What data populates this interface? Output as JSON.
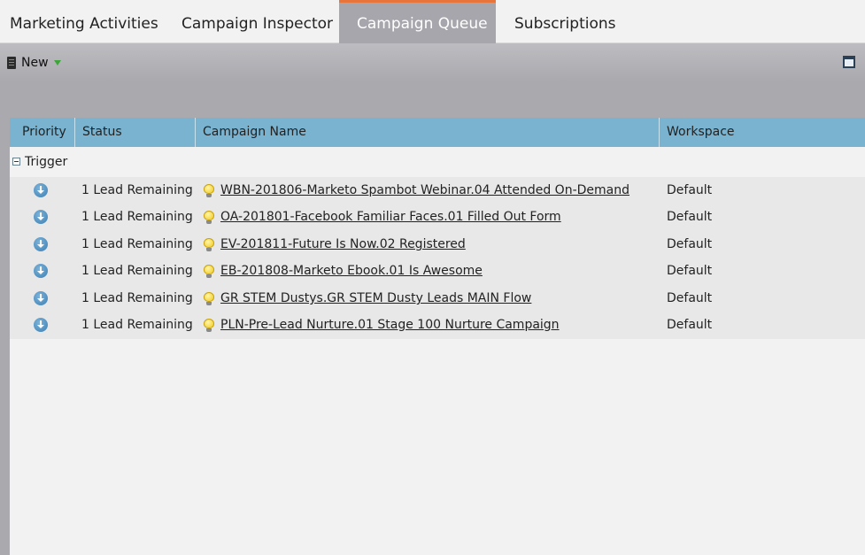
{
  "tabs": [
    {
      "label": "Marketing Activities",
      "active": false
    },
    {
      "label": "Campaign Inspector",
      "active": false
    },
    {
      "label": "Campaign Queue",
      "active": true
    },
    {
      "label": "Subscriptions",
      "active": false
    }
  ],
  "toolbar": {
    "new_label": "New",
    "new_icon": "document-icon",
    "new_caret_icon": "dropdown-caret-icon",
    "window_icon": "maximize-window-icon"
  },
  "grid": {
    "columns": [
      "Priority",
      "Status",
      "Campaign Name",
      "Workspace"
    ],
    "group": {
      "label": "Trigger",
      "icon": "collapse-icon"
    },
    "rows": [
      {
        "priority_icon": "priority-down-arrow-icon",
        "status": "1 Lead Remaining",
        "campaign_icon": "lightbulb-icon",
        "campaign_name": "WBN-201806-Marketo Spambot Webinar.04 Attended On-Demand",
        "workspace": "Default"
      },
      {
        "priority_icon": "priority-down-arrow-icon",
        "status": "1 Lead Remaining",
        "campaign_icon": "lightbulb-icon",
        "campaign_name": "OA-201801-Facebook Familiar Faces.01 Filled Out Form",
        "workspace": "Default"
      },
      {
        "priority_icon": "priority-down-arrow-icon",
        "status": "1 Lead Remaining",
        "campaign_icon": "lightbulb-icon",
        "campaign_name": "EV-201811-Future Is Now.02 Registered",
        "workspace": "Default"
      },
      {
        "priority_icon": "priority-down-arrow-icon",
        "status": "1 Lead Remaining",
        "campaign_icon": "lightbulb-icon",
        "campaign_name": "EB-201808-Marketo Ebook.01 Is Awesome",
        "workspace": "Default"
      },
      {
        "priority_icon": "priority-down-arrow-icon",
        "status": "1 Lead Remaining",
        "campaign_icon": "lightbulb-icon",
        "campaign_name": "GR STEM Dustys.GR STEM Dusty Leads MAIN Flow",
        "workspace": "Default"
      },
      {
        "priority_icon": "priority-down-arrow-icon",
        "status": "1 Lead Remaining",
        "campaign_icon": "lightbulb-icon",
        "campaign_name": "PLN-Pre-Lead Nurture.01 Stage 100 Nurture Campaign",
        "workspace": "Default"
      }
    ]
  },
  "colors": {
    "active_tab_accent": "#e8743b",
    "header_blue": "#79b3d0",
    "toolbar_gray": "#a9a9ae"
  }
}
